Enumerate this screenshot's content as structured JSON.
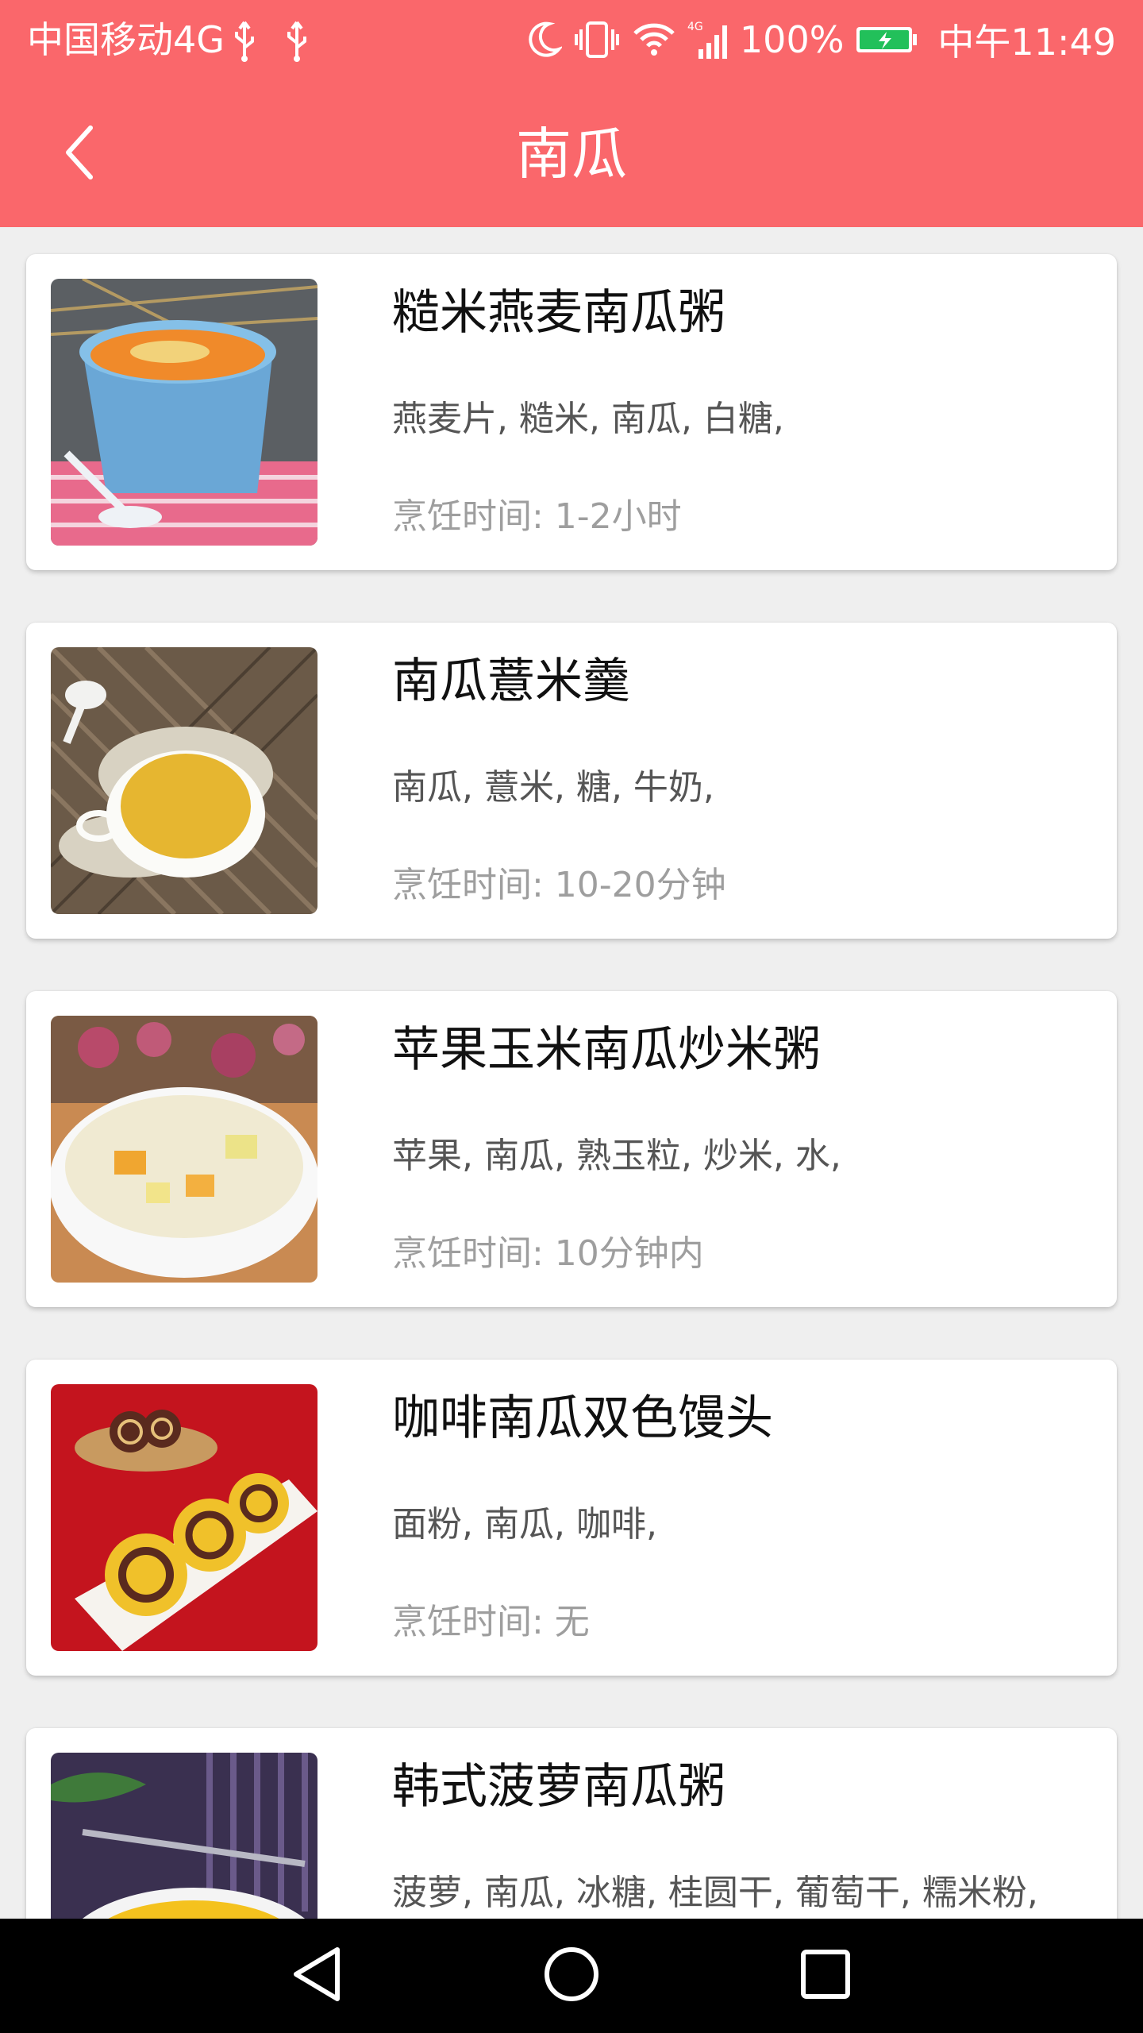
{
  "status_bar": {
    "carrier": "中国移动4G",
    "battery_percent": "100%",
    "time": "中午11:49",
    "network_badge": "4G"
  },
  "header": {
    "title": "南瓜",
    "back_icon": "chevron-left-icon"
  },
  "recipes": [
    {
      "title": "糙米燕麦南瓜粥",
      "ingredients": "燕麦片, 糙米, 南瓜, 白糖,",
      "cook_time": "烹饪时间: 1-2小时"
    },
    {
      "title": "南瓜薏米羹",
      "ingredients": "南瓜, 薏米, 糖, 牛奶,",
      "cook_time": "烹饪时间: 10-20分钟"
    },
    {
      "title": "苹果玉米南瓜炒米粥",
      "ingredients": "苹果, 南瓜, 熟玉粒, 炒米, 水,",
      "cook_time": "烹饪时间: 10分钟内"
    },
    {
      "title": "咖啡南瓜双色馒头",
      "ingredients": "面粉, 南瓜, 咖啡,",
      "cook_time": "烹饪时间: 无"
    },
    {
      "title": "韩式菠萝南瓜粥",
      "ingredients": "菠萝, 南瓜, 冰糖, 桂圆干, 葡萄干, 糯米粉,",
      "cook_time": ""
    }
  ],
  "colors": {
    "accent": "#fa676b",
    "background": "#efefef",
    "card": "#ffffff",
    "title_text": "#111111",
    "ingredient_text": "#555555",
    "time_text": "#9e9e9e"
  }
}
